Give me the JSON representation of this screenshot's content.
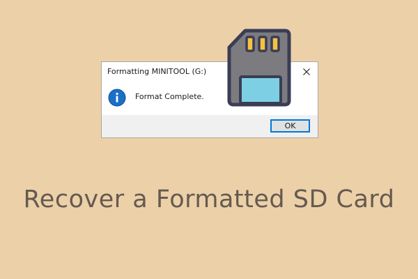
{
  "dialog": {
    "title": "Formatting MINITOOL (G:)",
    "message": "Format Complete.",
    "ok_label": "OK",
    "icon": "info-icon"
  },
  "illustration": {
    "icon": "sd-card-icon",
    "colors": {
      "body": "#7c7c80",
      "outline": "#3a3d55",
      "contacts": "#f5c242",
      "label": "#7dd0e3"
    }
  },
  "headline": "Recover a Formatted SD Card",
  "colors": {
    "background": "#ecd0a8",
    "headline": "#655a50",
    "info_blue": "#1c6fc6",
    "button_border": "#0078d7"
  }
}
